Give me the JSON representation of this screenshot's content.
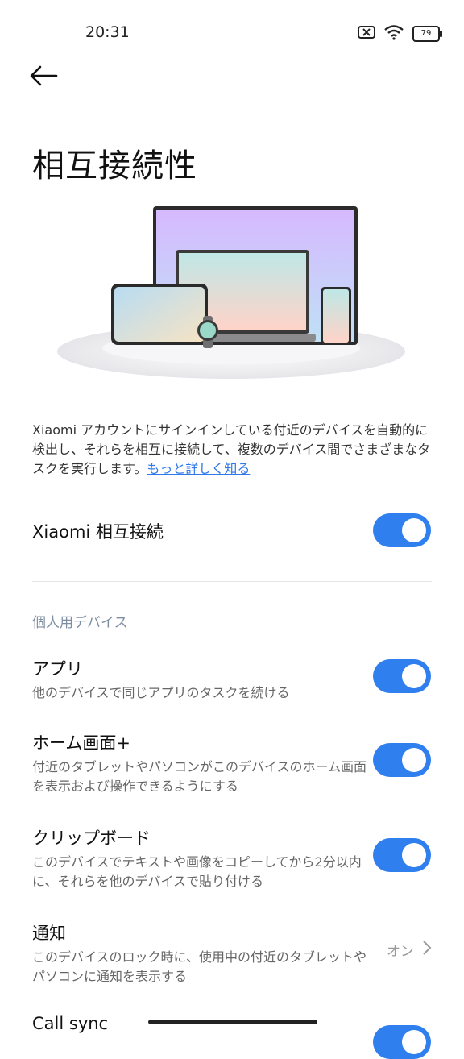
{
  "status_bar": {
    "time": "20:31",
    "battery": "79"
  },
  "header": {
    "title": "相互接続性"
  },
  "intro": {
    "text": "Xiaomi アカウントにサインインしている付近のデバイスを自動的に検出し、それらを相互に接続して、複数のデバイス間でさまざまなタスクを実行します。",
    "link": "もっと詳しく知る"
  },
  "main_toggle": {
    "label": "Xiaomi 相互接続",
    "enabled": true
  },
  "section": {
    "label": "個人用デバイス"
  },
  "settings": [
    {
      "title": "アプリ",
      "description": "他のデバイスで同じアプリのタスクを続ける",
      "enabled": true
    },
    {
      "title": "ホーム画面+",
      "description": "付近のタブレットやパソコンがこのデバイスのホーム画面を表示および操作できるようにする",
      "enabled": true
    },
    {
      "title": "クリップボード",
      "description": "このデバイスでテキストや画像をコピーしてから2分以内に、それらを他のデバイスで貼り付ける",
      "enabled": true
    },
    {
      "title": "通知",
      "description": "このデバイスのロック時に、使用中の付近のタブレットやパソコンに通知を表示する",
      "value": "オン"
    },
    {
      "title": "Call sync",
      "enabled": true
    }
  ],
  "colors": {
    "accent": "#2f7fef",
    "link": "#2f78e8"
  }
}
